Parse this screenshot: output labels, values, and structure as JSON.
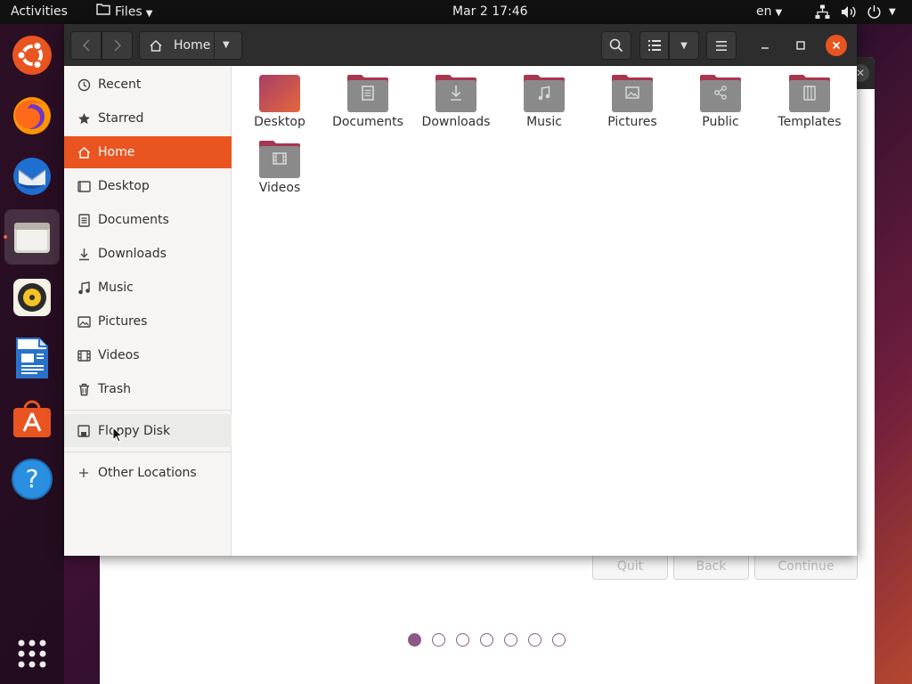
{
  "topbar": {
    "activities": "Activities",
    "app_menu": "Files",
    "clock": "Mar 2  17:46",
    "language": "en",
    "icons": [
      "network-icon",
      "volume-icon",
      "power-icon"
    ]
  },
  "dock": {
    "items": [
      "ubuntu-installer",
      "firefox",
      "thunderbird",
      "files",
      "rhythmbox",
      "libreoffice-writer",
      "ubuntu-software",
      "help",
      "show-applications"
    ]
  },
  "installer": {
    "buttons": {
      "quit": "Quit",
      "back": "Back",
      "continue": "Continue"
    },
    "page_dots": {
      "count": 7,
      "current": 1
    }
  },
  "files": {
    "path_label": "Home",
    "sidebar": {
      "items": [
        {
          "label": "Recent",
          "icon": "clock-icon"
        },
        {
          "label": "Starred",
          "icon": "star-icon"
        },
        {
          "label": "Home",
          "icon": "home-icon",
          "selected": true
        },
        {
          "label": "Desktop",
          "icon": "desktop-icon"
        },
        {
          "label": "Documents",
          "icon": "document-icon"
        },
        {
          "label": "Downloads",
          "icon": "download-icon"
        },
        {
          "label": "Music",
          "icon": "music-icon"
        },
        {
          "label": "Pictures",
          "icon": "picture-icon"
        },
        {
          "label": "Videos",
          "icon": "video-icon"
        },
        {
          "label": "Trash",
          "icon": "trash-icon"
        }
      ],
      "devices": [
        {
          "label": "Floppy Disk",
          "icon": "floppy-icon"
        }
      ],
      "other": {
        "label": "Other Locations",
        "icon": "plus-icon"
      }
    },
    "folders": [
      {
        "label": "Desktop",
        "icon": "desktop-folder-icon"
      },
      {
        "label": "Documents",
        "icon": "documents-folder-icon"
      },
      {
        "label": "Downloads",
        "icon": "downloads-folder-icon"
      },
      {
        "label": "Music",
        "icon": "music-folder-icon"
      },
      {
        "label": "Pictures",
        "icon": "pictures-folder-icon"
      },
      {
        "label": "Public",
        "icon": "public-folder-icon"
      },
      {
        "label": "Templates",
        "icon": "templates-folder-icon"
      },
      {
        "label": "Videos",
        "icon": "videos-folder-icon"
      }
    ]
  },
  "colors": {
    "accent": "#e95420",
    "folder_tab": "#a8364f",
    "folder_body": "#8a8a8a"
  }
}
